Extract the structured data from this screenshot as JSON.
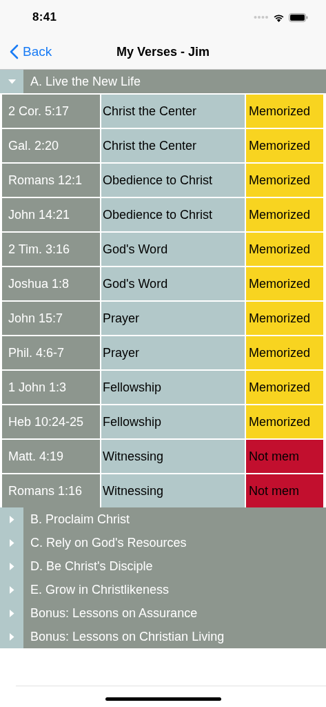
{
  "status_bar": {
    "time": "8:41"
  },
  "nav": {
    "back": "Back",
    "title": "My Verses - Jim"
  },
  "sections": [
    {
      "title": "A. Live the New Life",
      "expanded": true,
      "rows": [
        {
          "reference": "2 Cor. 5:17",
          "topic": "Christ the Center",
          "status": "Memorized",
          "memorized": true
        },
        {
          "reference": "Gal. 2:20",
          "topic": "Christ the Center",
          "status": "Memorized",
          "memorized": true
        },
        {
          "reference": "Romans 12:1",
          "topic": "Obedience to Christ",
          "status": "Memorized",
          "memorized": true
        },
        {
          "reference": "John 14:21",
          "topic": "Obedience to Christ",
          "status": "Memorized",
          "memorized": true
        },
        {
          "reference": "2 Tim. 3:16",
          "topic": "God's Word",
          "status": "Memorized",
          "memorized": true
        },
        {
          "reference": "Joshua 1:8",
          "topic": "God's Word",
          "status": "Memorized",
          "memorized": true
        },
        {
          "reference": "John 15:7",
          "topic": "Prayer",
          "status": "Memorized",
          "memorized": true
        },
        {
          "reference": "Phil. 4:6-7",
          "topic": "Prayer",
          "status": "Memorized",
          "memorized": true
        },
        {
          "reference": "1 John 1:3",
          "topic": "Fellowship",
          "status": "Memorized",
          "memorized": true
        },
        {
          "reference": "Heb 10:24-25",
          "topic": "Fellowship",
          "status": "Memorized",
          "memorized": true
        },
        {
          "reference": "Matt. 4:19",
          "topic": "Witnessing",
          "status": "Not mem",
          "memorized": false
        },
        {
          "reference": "Romans 1:16",
          "topic": "Witnessing",
          "status": "Not mem",
          "memorized": false
        }
      ]
    },
    {
      "title": "B. Proclaim Christ",
      "expanded": false
    },
    {
      "title": "C. Rely on God's Resources",
      "expanded": false
    },
    {
      "title": "D. Be Christ's Disciple",
      "expanded": false
    },
    {
      "title": "E. Grow in Christlikeness",
      "expanded": false
    },
    {
      "title": "Bonus: Lessons on Assurance",
      "expanded": false
    },
    {
      "title": "Bonus: Lessons on Christian Living",
      "expanded": false
    }
  ]
}
